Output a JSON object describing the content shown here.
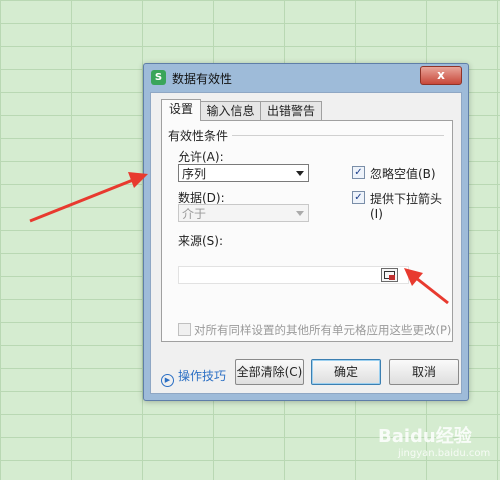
{
  "dialog": {
    "title": "数据有效性",
    "app_icon": "S",
    "close_glyph": "x"
  },
  "tabs": [
    {
      "label": "设置",
      "active": true
    },
    {
      "label": "输入信息",
      "active": false
    },
    {
      "label": "出错警告",
      "active": false
    }
  ],
  "settings": {
    "group_title": "有效性条件",
    "allow_label": "允许(A):",
    "allow_value": "序列",
    "data_label": "数据(D):",
    "data_value": "介于",
    "ignore_blank_label": "忽略空值(B)",
    "ignore_blank_checked": true,
    "dropdown_label": "提供下拉箭头(I)",
    "dropdown_checked": true,
    "source_label": "来源(S):",
    "source_value": "",
    "apply_all_label": "对所有同样设置的其他所有单元格应用这些更改(P)",
    "apply_all_checked": false
  },
  "footer": {
    "tips_label": "操作技巧",
    "clear_all_label": "全部清除(C)",
    "ok_label": "确定",
    "cancel_label": "取消"
  },
  "watermark": {
    "text": "Baidu经验",
    "sub": "jingyan.baidu.com"
  },
  "colors": {
    "accent_arrow": "#e83a2f",
    "link": "#2b6fc4"
  }
}
